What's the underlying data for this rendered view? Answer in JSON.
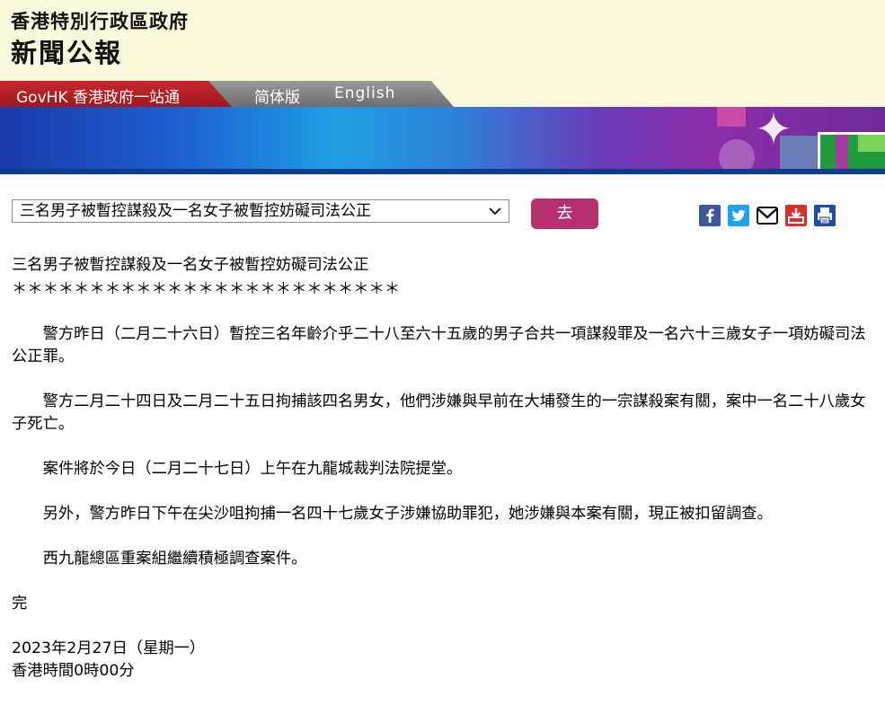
{
  "header": {
    "gov_name": "香港特別行政區政府",
    "press_name": "新聞公報"
  },
  "nav": {
    "govhk": "GovHK 香港政府一站通",
    "simplified": "简体版",
    "english": "English"
  },
  "controls": {
    "select_value": "三名男子被暫控謀殺及一名女子被暫控妨礙司法公正",
    "go_label": "去"
  },
  "share": {
    "facebook": "facebook-icon",
    "twitter": "twitter-icon",
    "email": "email-icon",
    "download": "download-icon",
    "print": "print-icon"
  },
  "article": {
    "title": "三名男子被暫控謀殺及一名女子被暫控妨礙司法公正",
    "stars": "＊＊＊＊＊＊＊＊＊＊＊＊＊＊＊＊＊＊＊＊＊＊＊＊＊",
    "paragraphs": [
      "警方昨日（二月二十六日）暫控三名年齡介乎二十八至六十五歲的男子合共一項謀殺罪及一名六十三歲女子一項妨礙司法公正罪。",
      "警方二月二十四日及二月二十五日拘捕該四名男女，他們涉嫌與早前在大埔發生的一宗謀殺案有關，案中一名二十八歲女子死亡。",
      "案件將於今日（二月二十七日）上午在九龍城裁判法院提堂。",
      "另外，警方昨日下午在尖沙咀拘捕一名四十七歲女子涉嫌協助罪犯，她涉嫌與本案有關，現正被扣留調查。",
      "西九龍總區重案組繼續積極調查案件。"
    ],
    "end": "完",
    "date": "2023年2月27日（星期一）",
    "time": "香港時間0時00分"
  },
  "colors": {
    "header_bg": "#fbf8dc",
    "nav_red": "#b5202a",
    "nav_gray": "#808080",
    "go_button": "#b6306f"
  }
}
